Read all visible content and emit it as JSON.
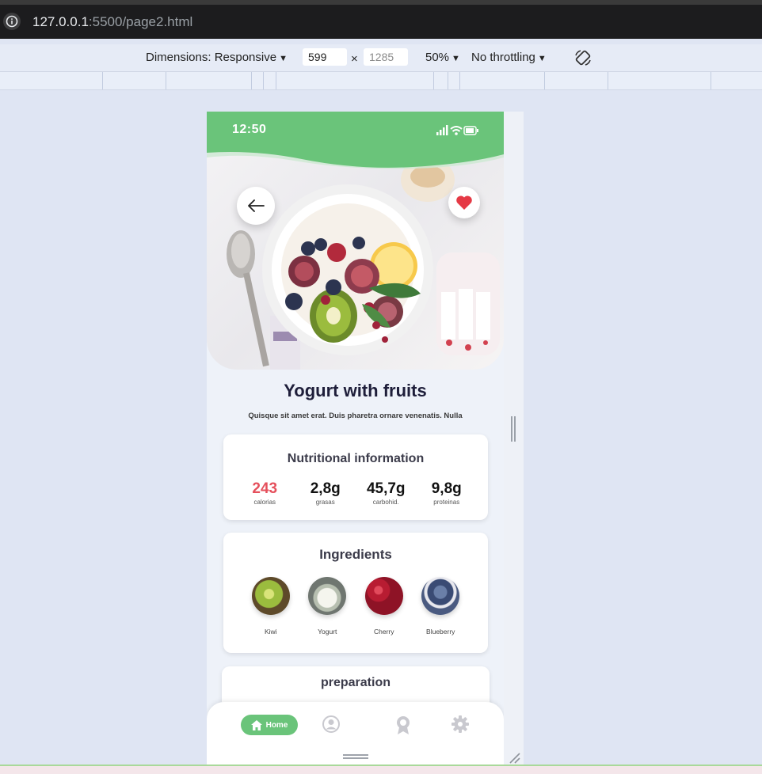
{
  "browser": {
    "url_host": "127.0.0.1",
    "url_rest": ":5500/page2.html"
  },
  "devtools": {
    "dimensions_label": "Dimensions: Responsive",
    "width_value": "599",
    "height_value": "1285",
    "times_sign": "×",
    "zoom_label": "50%",
    "throttle_label": "No throttling"
  },
  "app": {
    "status_time": "12:50",
    "title": "Yogurt with fruits",
    "subtitle": "Quisque sit amet erat. Duis pharetra ornare venenatis. Nulla",
    "nutrition": {
      "title": "Nutritional information",
      "items": [
        {
          "value": "243",
          "label": "calorias"
        },
        {
          "value": "2,8g",
          "label": "grasas"
        },
        {
          "value": "45,7g",
          "label": "carbohid."
        },
        {
          "value": "9,8g",
          "label": "proteinas"
        }
      ]
    },
    "ingredients": {
      "title": "Ingredients",
      "items": [
        {
          "label": "Kiwi"
        },
        {
          "label": "Yogurt"
        },
        {
          "label": "Cherry"
        },
        {
          "label": "Blueberry"
        }
      ]
    },
    "preparation": {
      "title": "preparation"
    },
    "nav": {
      "home_label": "Home"
    },
    "colors": {
      "accent_green": "#6ac47a",
      "calorie_red": "#e5505c",
      "heart_red": "#e53945"
    }
  }
}
